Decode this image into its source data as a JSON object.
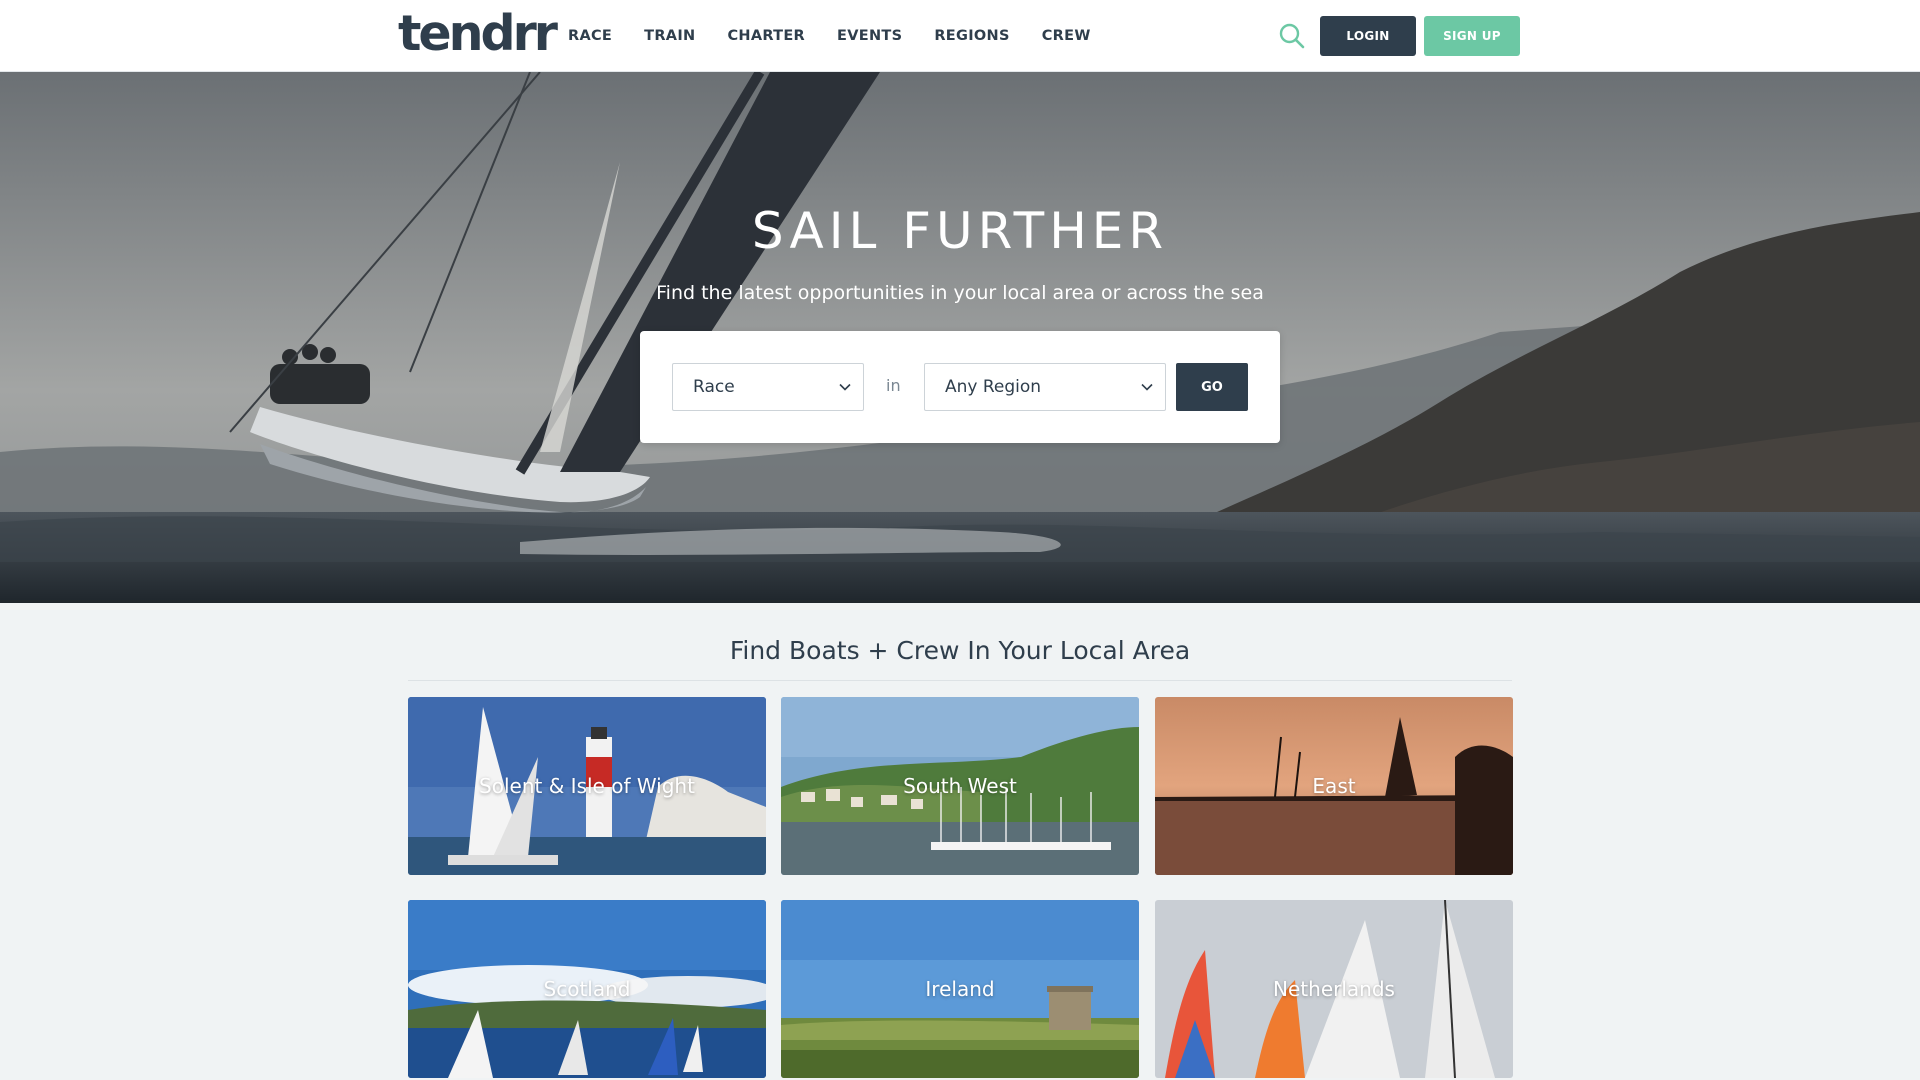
{
  "header": {
    "logo": "tendrr",
    "nav": [
      "RACE",
      "TRAIN",
      "CHARTER",
      "EVENTS",
      "REGIONS",
      "CREW"
    ],
    "search_icon": "search-icon",
    "login_label": "LOGIN",
    "signup_label": "SIGN UP"
  },
  "hero": {
    "title": "SAIL FURTHER",
    "subtitle": "Find the latest opportunities in your local area or across the sea",
    "search": {
      "type_value": "Race",
      "in_label": "in",
      "region_value": "Any Region",
      "go_label": "GO"
    }
  },
  "regions_section": {
    "title": "Find Boats + Crew In Your Local Area",
    "tiles": [
      {
        "label": "Solent & Isle of Wight"
      },
      {
        "label": "South West"
      },
      {
        "label": "East"
      },
      {
        "label": "Scotland"
      },
      {
        "label": "Ireland"
      },
      {
        "label": "Netherlands"
      }
    ]
  },
  "colors": {
    "navy": "#2f3e4c",
    "mint": "#6cc8a4",
    "page_bg": "#f0f3f4"
  }
}
